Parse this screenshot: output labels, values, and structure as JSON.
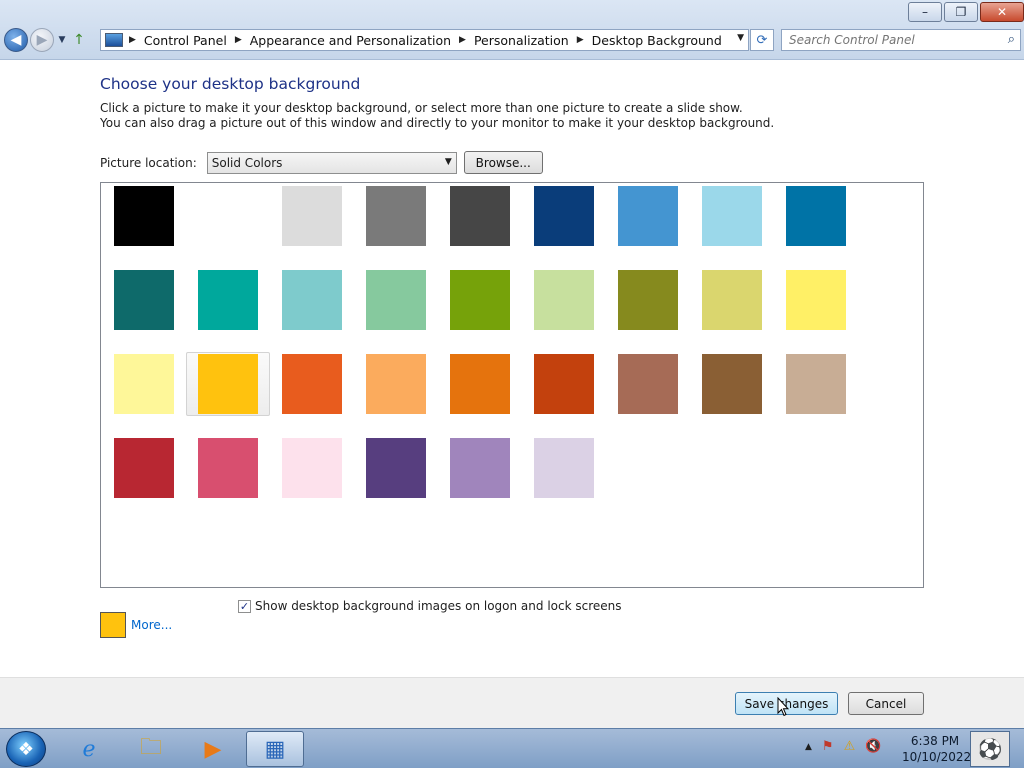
{
  "window": {
    "controls": {
      "minimize": "–",
      "restore": "❐",
      "close": "✕"
    }
  },
  "address_bar": {
    "crumbs": [
      "Control Panel",
      "Appearance and Personalization",
      "Personalization",
      "Desktop Background"
    ],
    "separator": "▶",
    "dropdown": "▼",
    "refresh": "⟳"
  },
  "search": {
    "placeholder": "Search Control Panel",
    "icon": "⌕"
  },
  "nav": {
    "back": "◀",
    "forward": "▶",
    "recent": "▼",
    "up": "↑"
  },
  "page": {
    "heading": "Choose your desktop background",
    "desc_line1": "Click a picture to make it your desktop background, or select more than one picture to create a slide show.",
    "desc_line2": "You can also drag a picture out of this window and directly to your monitor to make it your desktop background.",
    "location_label": "Picture location:",
    "location_value": "Solid Colors",
    "location_arrow": "▼",
    "browse_label": "Browse..."
  },
  "colors": [
    "#000000",
    "#ffffff",
    "#dcdcdc",
    "#7a7a7a",
    "#464646",
    "#0a3d7a",
    "#4495d1",
    "#9bd8ea",
    "#0073a6",
    "#0e6a6a",
    "#00a89c",
    "#7ecbcc",
    "#86c99e",
    "#76a20a",
    "#c7e09e",
    "#868a1e",
    "#dad66e",
    "#fff066",
    "#fef799",
    "#ffc20e",
    "#e85c1e",
    "#fbab5d",
    "#e5730d",
    "#c3410d",
    "#a66b56",
    "#8a5f34",
    "#c8ad95",
    "#b82732",
    "#d84f6f",
    "#fde1ec",
    "#573e7f",
    "#a085bc",
    "#dbd1e5"
  ],
  "selected_index": 19,
  "checkbox": {
    "label": "Show desktop background images on logon and lock screens",
    "checked": true,
    "mark": "✓"
  },
  "current_color": "#ffc20e",
  "more_link": "More...",
  "footer": {
    "save_label": "Save changes",
    "cancel_label": "Cancel"
  },
  "taskbar": {
    "start_glyph": "❖",
    "items": [
      {
        "name": "internet-explorer",
        "glyph": "ℯ"
      },
      {
        "name": "windows-explorer",
        "glyph": "🗀"
      },
      {
        "name": "media-player",
        "glyph": "▶"
      },
      {
        "name": "control-panel",
        "glyph": "▦",
        "active": true
      }
    ],
    "tray": {
      "show_hidden": "▲",
      "action_center": "⚑",
      "warning": "⚠",
      "volume": "🔇"
    },
    "time": "6:38 PM",
    "date": "10/10/2022",
    "show_desktop_glyph": "⚽"
  }
}
